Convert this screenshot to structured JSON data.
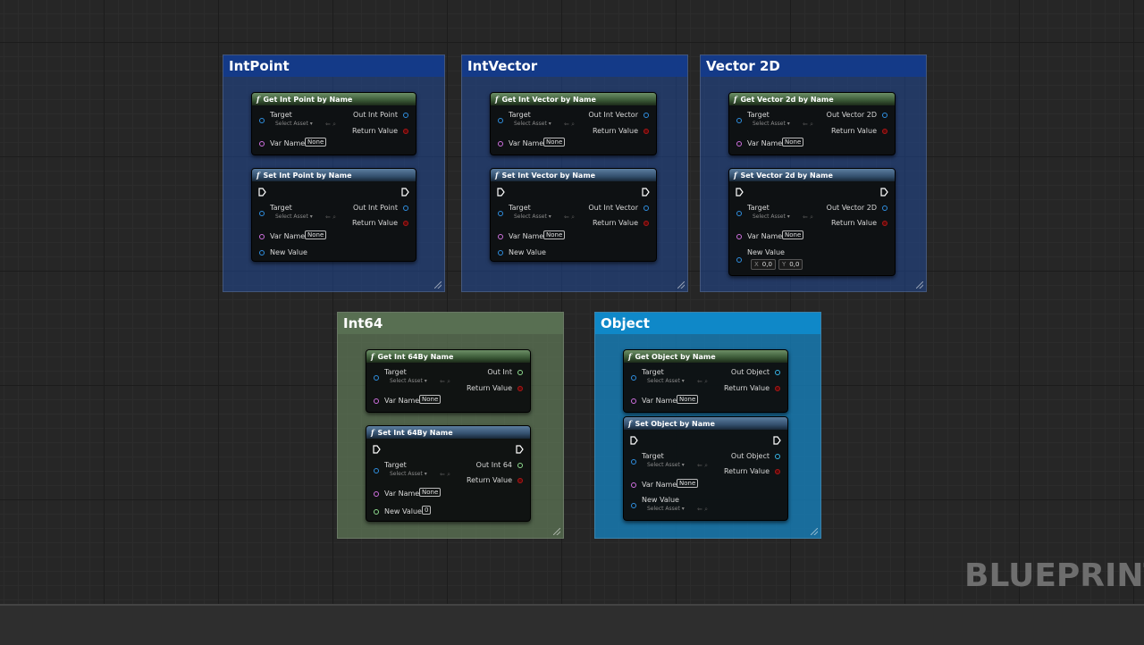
{
  "brand": "BLUEPRINT",
  "common": {
    "target": "Target",
    "select_asset": "Select Asset ▾",
    "var_name": "Var Name",
    "none": "None",
    "return_value": "Return Value",
    "new_value": "New Value",
    "func_icon": "f"
  },
  "groups": {
    "intpoint": {
      "title": "IntPoint",
      "get": {
        "title": "Get Int Point by Name",
        "out": "Out Int Point"
      },
      "set": {
        "title": "Set Int Point by Name",
        "out": "Out Int Point"
      }
    },
    "intvector": {
      "title": "IntVector",
      "get": {
        "title": "Get Int Vector by Name",
        "out": "Out Int Vector"
      },
      "set": {
        "title": "Set Int Vector by Name",
        "out": "Out Int Vector"
      }
    },
    "vector2d": {
      "title": "Vector 2D",
      "get": {
        "title": "Get Vector 2d by Name",
        "out": "Out Vector 2D"
      },
      "set": {
        "title": "Set Vector 2d by Name",
        "out": "Out Vector 2D",
        "x_label": "X",
        "x_value": "0,0",
        "y_label": "Y",
        "y_value": "0,0"
      }
    },
    "int64": {
      "title": "Int64",
      "get": {
        "title": "Get Int 64By Name",
        "out": "Out Int"
      },
      "set": {
        "title": "Set Int 64By Name",
        "out": "Out Int 64",
        "new_value_default": "0"
      }
    },
    "object": {
      "title": "Object",
      "get": {
        "title": "Get Object by Name",
        "out": "Out Object"
      },
      "set": {
        "title": "Set Object by Name",
        "out": "Out Object"
      }
    }
  },
  "colors": {
    "blue_comment": "#1f3a68",
    "green_comment": "#566b4f",
    "cyan_comment": "#1b7fb8",
    "get_header": "#4f6f4a",
    "set_header": "#3f5f80"
  }
}
